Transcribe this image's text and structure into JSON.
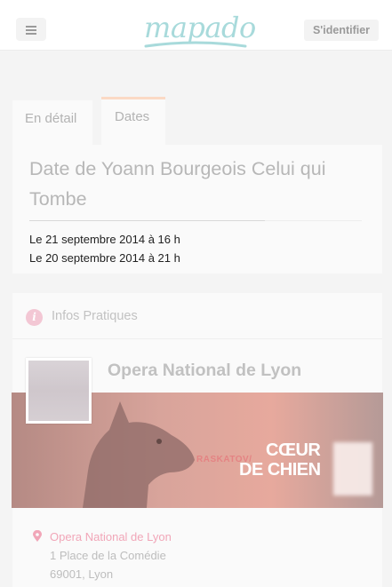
{
  "header": {
    "logo_text": "mapado",
    "login_label": "S'identifier",
    "icons": {
      "menu": "hamburger-menu-icon"
    }
  },
  "tabs": [
    {
      "label": "En détail",
      "active": false
    },
    {
      "label": "Dates",
      "active": true
    }
  ],
  "dates": {
    "title": "Date de Yoann Bourgeois Celui qui Tombe",
    "items": [
      "Le 21 septembre 2014 à 16 h",
      "Le 20 septembre 2014 à 21 h"
    ]
  },
  "infos": {
    "section_label": "Infos Pratiques",
    "icons": {
      "section": "info-icon",
      "address": "map-pin-icon"
    },
    "venue": {
      "name": "Opera National de Lyon",
      "banner_small_text": "RASKATOV/",
      "banner_title_1": "CŒUR",
      "banner_title_2": "DE CHIEN",
      "address_link": "Opera National de Lyon",
      "address_line1": "1 Place de la Comédie",
      "address_line2": "69001, Lyon"
    }
  },
  "colors": {
    "accent_tab": "#fbd9c4",
    "logo": "#a8dadb",
    "link_pink": "#f1a6b8",
    "info_icon": "#f3c7d4"
  }
}
